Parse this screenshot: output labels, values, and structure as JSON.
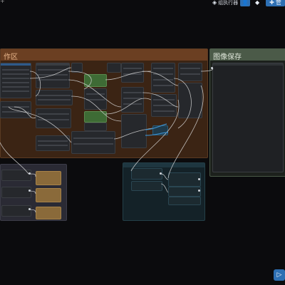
{
  "topbar": {
    "left_glyph": "+",
    "queue_label": "组执行器",
    "queue_icon": "layers-icon",
    "settings_label": "管",
    "settings_icon": "puzzle-icon",
    "nodes_icon": "bookmark-icon",
    "user_icon": "user-icon"
  },
  "groups": {
    "workspace_title": "作区",
    "save_title": "图像保存"
  },
  "run": {
    "icon": "play-icon",
    "symbol": "▷"
  }
}
